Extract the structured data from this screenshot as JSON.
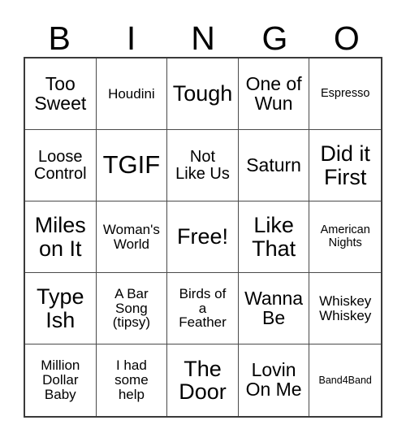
{
  "header": {
    "letters": [
      "B",
      "I",
      "N",
      "G",
      "O"
    ]
  },
  "colors": {
    "background": "#ffffff",
    "cell_background": "#ffffff",
    "text": "#000000",
    "grid_outer_border": "#3a3a3a",
    "grid_inner_border": "#4a4a4a"
  },
  "grid": {
    "columns": 5,
    "rows": 5,
    "cells": [
      {
        "text": "Too\nSweet",
        "size": "fs-xl"
      },
      {
        "text": "Houdini",
        "size": "fs-md"
      },
      {
        "text": "Tough",
        "size": "fs-2xl"
      },
      {
        "text": "One of\nWun",
        "size": "fs-xl"
      },
      {
        "text": "Espresso",
        "size": "fs-sm"
      },
      {
        "text": "Loose\nControl",
        "size": "fs-lg"
      },
      {
        "text": "TGIF",
        "size": "fs-3xl"
      },
      {
        "text": "Not\nLike Us",
        "size": "fs-lg"
      },
      {
        "text": "Saturn",
        "size": "fs-xl"
      },
      {
        "text": "Did it\nFirst",
        "size": "fs-2xl"
      },
      {
        "text": "Miles\non It",
        "size": "fs-2xl"
      },
      {
        "text": "Woman's\nWorld",
        "size": "fs-md"
      },
      {
        "text": "Free!",
        "size": "fs-2xl"
      },
      {
        "text": "Like\nThat",
        "size": "fs-2xl"
      },
      {
        "text": "American\nNights",
        "size": "fs-sm"
      },
      {
        "text": "Type\nIsh",
        "size": "fs-2xl"
      },
      {
        "text": "A Bar\nSong\n(tipsy)",
        "size": "fs-md"
      },
      {
        "text": "Birds of\na\nFeather",
        "size": "fs-md"
      },
      {
        "text": "Wanna\nBe",
        "size": "fs-xl"
      },
      {
        "text": "Whiskey\nWhiskey",
        "size": "fs-md"
      },
      {
        "text": "Million\nDollar\nBaby",
        "size": "fs-md"
      },
      {
        "text": "I had\nsome\nhelp",
        "size": "fs-md"
      },
      {
        "text": "The\nDoor",
        "size": "fs-2xl"
      },
      {
        "text": "Lovin\nOn Me",
        "size": "fs-xl"
      },
      {
        "text": "Band4Band",
        "size": "fs-xs"
      }
    ]
  }
}
